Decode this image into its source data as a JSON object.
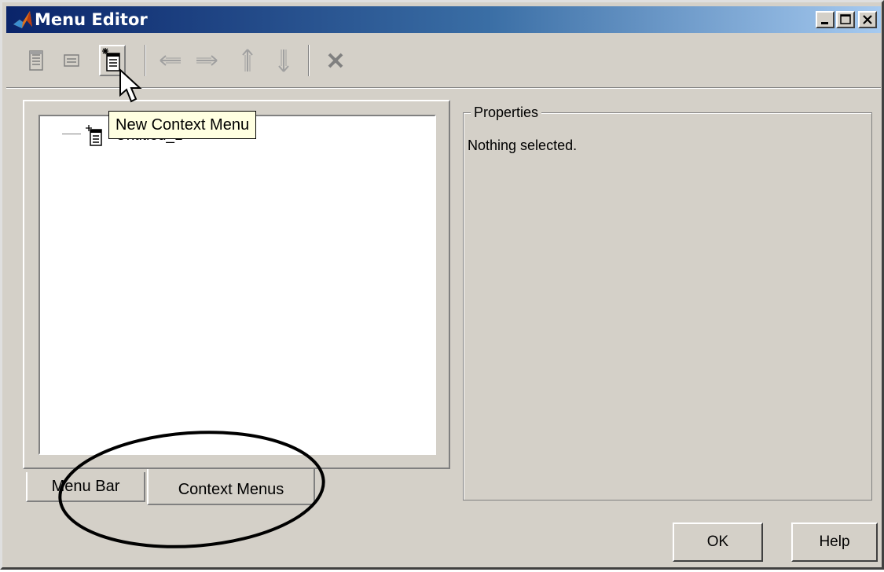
{
  "window": {
    "title": "Menu Editor",
    "icon": "matlab-logo-icon",
    "controls": [
      "minimize-icon",
      "maximize-icon",
      "close-icon"
    ]
  },
  "toolbar": {
    "buttons": [
      {
        "icon": "new-menu-icon",
        "state": "normal"
      },
      {
        "icon": "new-menu-item-icon",
        "state": "normal"
      },
      {
        "icon": "new-context-menu-icon",
        "state": "hover"
      },
      {
        "icon": "arrow-left-icon",
        "state": "disabled"
      },
      {
        "icon": "arrow-right-icon",
        "state": "disabled"
      },
      {
        "icon": "arrow-up-icon",
        "state": "disabled"
      },
      {
        "icon": "arrow-down-icon",
        "state": "disabled"
      },
      {
        "icon": "delete-icon",
        "state": "disabled"
      }
    ]
  },
  "tooltip": {
    "text": "New Context Menu"
  },
  "tree": {
    "node_label": "Untitled_1"
  },
  "tabs": [
    {
      "label": "Menu Bar",
      "selected": false
    },
    {
      "label": "Context Menus",
      "selected": true
    }
  ],
  "properties": {
    "legend": "Properties",
    "status": "Nothing selected."
  },
  "buttons": {
    "ok": "OK",
    "help": "Help"
  },
  "colors": {
    "dialog_bg": "#d4d0c8",
    "titlebar_start": "#0a246a",
    "titlebar_end": "#a6caf0",
    "tooltip_bg": "#ffffe1",
    "disabled_icon": "#a0a0a0"
  }
}
